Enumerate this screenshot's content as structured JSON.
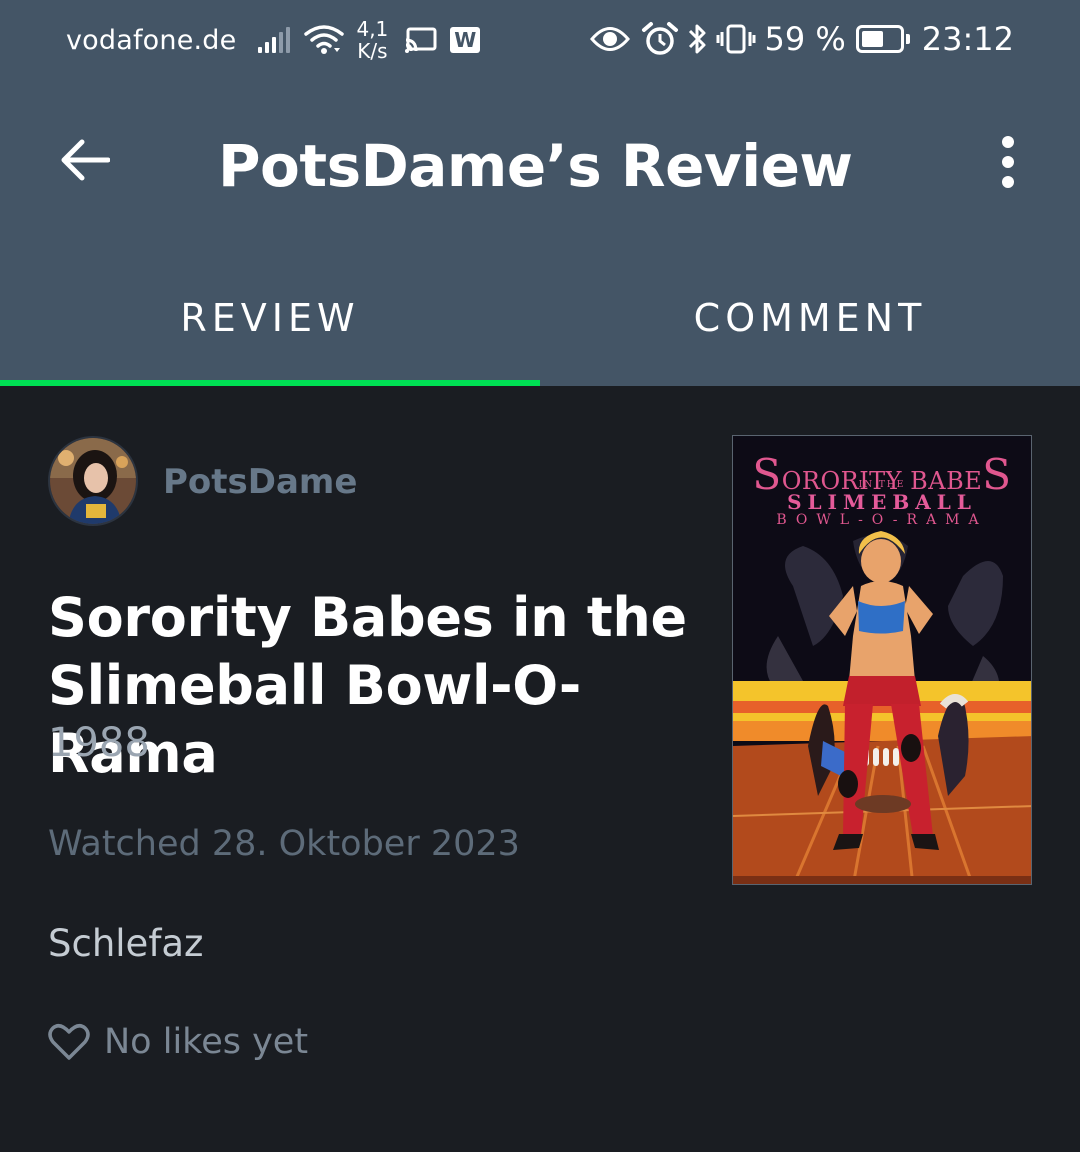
{
  "status_bar": {
    "carrier": "vodafone.de",
    "net_speed_value": "4,1",
    "net_speed_unit": "K/s",
    "notification_badge": "W",
    "battery_percent": "59 %",
    "battery_level": 0.59,
    "time": "23:12",
    "icons": [
      "signal-icon",
      "wifi-icon",
      "cast-icon",
      "w-app-icon",
      "eye-icon",
      "alarm-icon",
      "bluetooth-icon",
      "vibrate-icon",
      "battery-icon"
    ]
  },
  "app_bar": {
    "title": "PotsDame’s Review",
    "back_icon": "arrow-back-icon",
    "more_icon": "more-vert-icon"
  },
  "tabs": [
    {
      "label": "REVIEW",
      "selected": true
    },
    {
      "label": "COMMENT",
      "selected": false
    }
  ],
  "colors": {
    "header_bg": "#445566",
    "body_bg": "#1a1d22",
    "accent_green": "#00e054"
  },
  "review": {
    "username": "PotsDame",
    "film_title": "Sorority Babes in the Slimeball Bowl-O-Rama",
    "film_year": "1988",
    "watched": "Watched 28. Oktober 2023",
    "text": "Schlefaz",
    "likes": "No likes yet"
  },
  "poster": {
    "title_first_letter": "S",
    "title_middle": "ORORITY BABE",
    "title_last_letter": "S",
    "line2": "IN THE",
    "line3": "SLIMEBALL",
    "line4": "BOWL-O-RAMA"
  }
}
